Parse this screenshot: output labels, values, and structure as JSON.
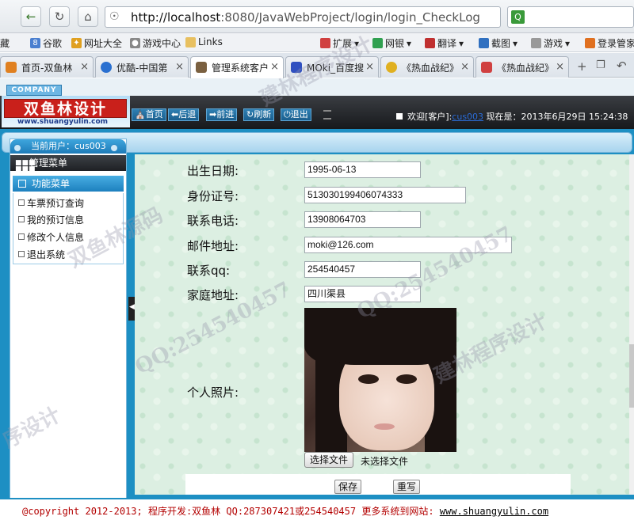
{
  "browser": {
    "url_host": "http://localhost",
    "url_rest": ":8080/JavaWebProject/login/login_CheckLog",
    "bookmarks": [
      "藏",
      "谷歌",
      "网址大全",
      "游戏中心",
      "Links",
      "扩展",
      "网银",
      "翻译",
      "截图",
      "游戏",
      "登录管家"
    ],
    "tabs": [
      "首页-双鱼林",
      "优酷-中国第",
      "管理系统客户",
      "MOki_百度搜",
      "《热血战纪》",
      "《热血战纪》"
    ]
  },
  "app": {
    "company_badge": "COMPANY",
    "logo_text": "双鱼林设计",
    "logo_url": "www.shuangyulin.com",
    "nav_buttons": [
      "首页",
      "后退",
      "前进",
      "刷新",
      "退出"
    ],
    "welcome_prefix": "欢迎[客户]:",
    "welcome_user": "cus003",
    "welcome_suffix": "现在是：2013年6月29日 15:24:38",
    "sidebar": {
      "current_user": "当前用户：cus003",
      "mgmt_menu": "管理菜单",
      "func_menu": "功能菜单",
      "items": [
        "车票预订查询",
        "我的预订信息",
        "修改个人信息",
        "退出系统"
      ]
    },
    "form": {
      "fields": [
        {
          "label": "出生日期:",
          "value": "1995-06-13"
        },
        {
          "label": "身份证号:",
          "value": "513030199406074333"
        },
        {
          "label": "联系电话:",
          "value": "13908064703"
        },
        {
          "label": "邮件地址:",
          "value": "moki@126.com"
        },
        {
          "label": "联系qq:",
          "value": "254540457"
        },
        {
          "label": "家庭地址:",
          "value": "四川渠县"
        }
      ],
      "photo_label": "个人照片:",
      "file_button": "选择文件",
      "file_status": "未选择文件",
      "save_button": "保存",
      "reset_button": "重写"
    },
    "footer": {
      "text": "@copyright 2012-2013; 程序开发:双鱼林  QQ:287307421或254540457  更多系统到网站: ",
      "site": "www.shuangyulin.com"
    },
    "watermarks": [
      "建林程序设计",
      "QQ:254540457",
      "双鱼林源码",
      "建林程序设计",
      "QQ:254540457",
      "序设计"
    ]
  },
  "colors": {
    "app_frame": "#1d8fc3",
    "header_dark": "#1e2024",
    "footer_text": "#b30000"
  }
}
